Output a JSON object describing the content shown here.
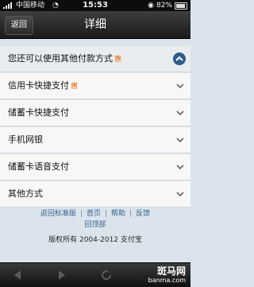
{
  "status_bar": {
    "carrier": "中国移动",
    "time": "15:53",
    "battery": "82%"
  },
  "nav": {
    "back_label": "返回",
    "title": "详细"
  },
  "list": {
    "header_label": "您还可以使用其他付款方式",
    "header_badge": "惠",
    "items": [
      {
        "label": "信用卡快捷支付",
        "badge": "惠"
      },
      {
        "label": "储蓄卡快捷支付",
        "badge": ""
      },
      {
        "label": "手机网银",
        "badge": ""
      },
      {
        "label": "储蓄卡语音支付",
        "badge": ""
      },
      {
        "label": "其他方式",
        "badge": ""
      }
    ]
  },
  "footer": {
    "links": [
      "返回标准版",
      "首页",
      "帮助",
      "反馈",
      "回顶部"
    ],
    "copyright": "版权所有 2004-2012 支付宝"
  },
  "watermark": {
    "name": "斑马网",
    "url": "banma.com"
  },
  "colors": {
    "accent_orange": "#f06a00",
    "link_blue": "#36618c",
    "bar_dark": "#1a1a1a"
  }
}
